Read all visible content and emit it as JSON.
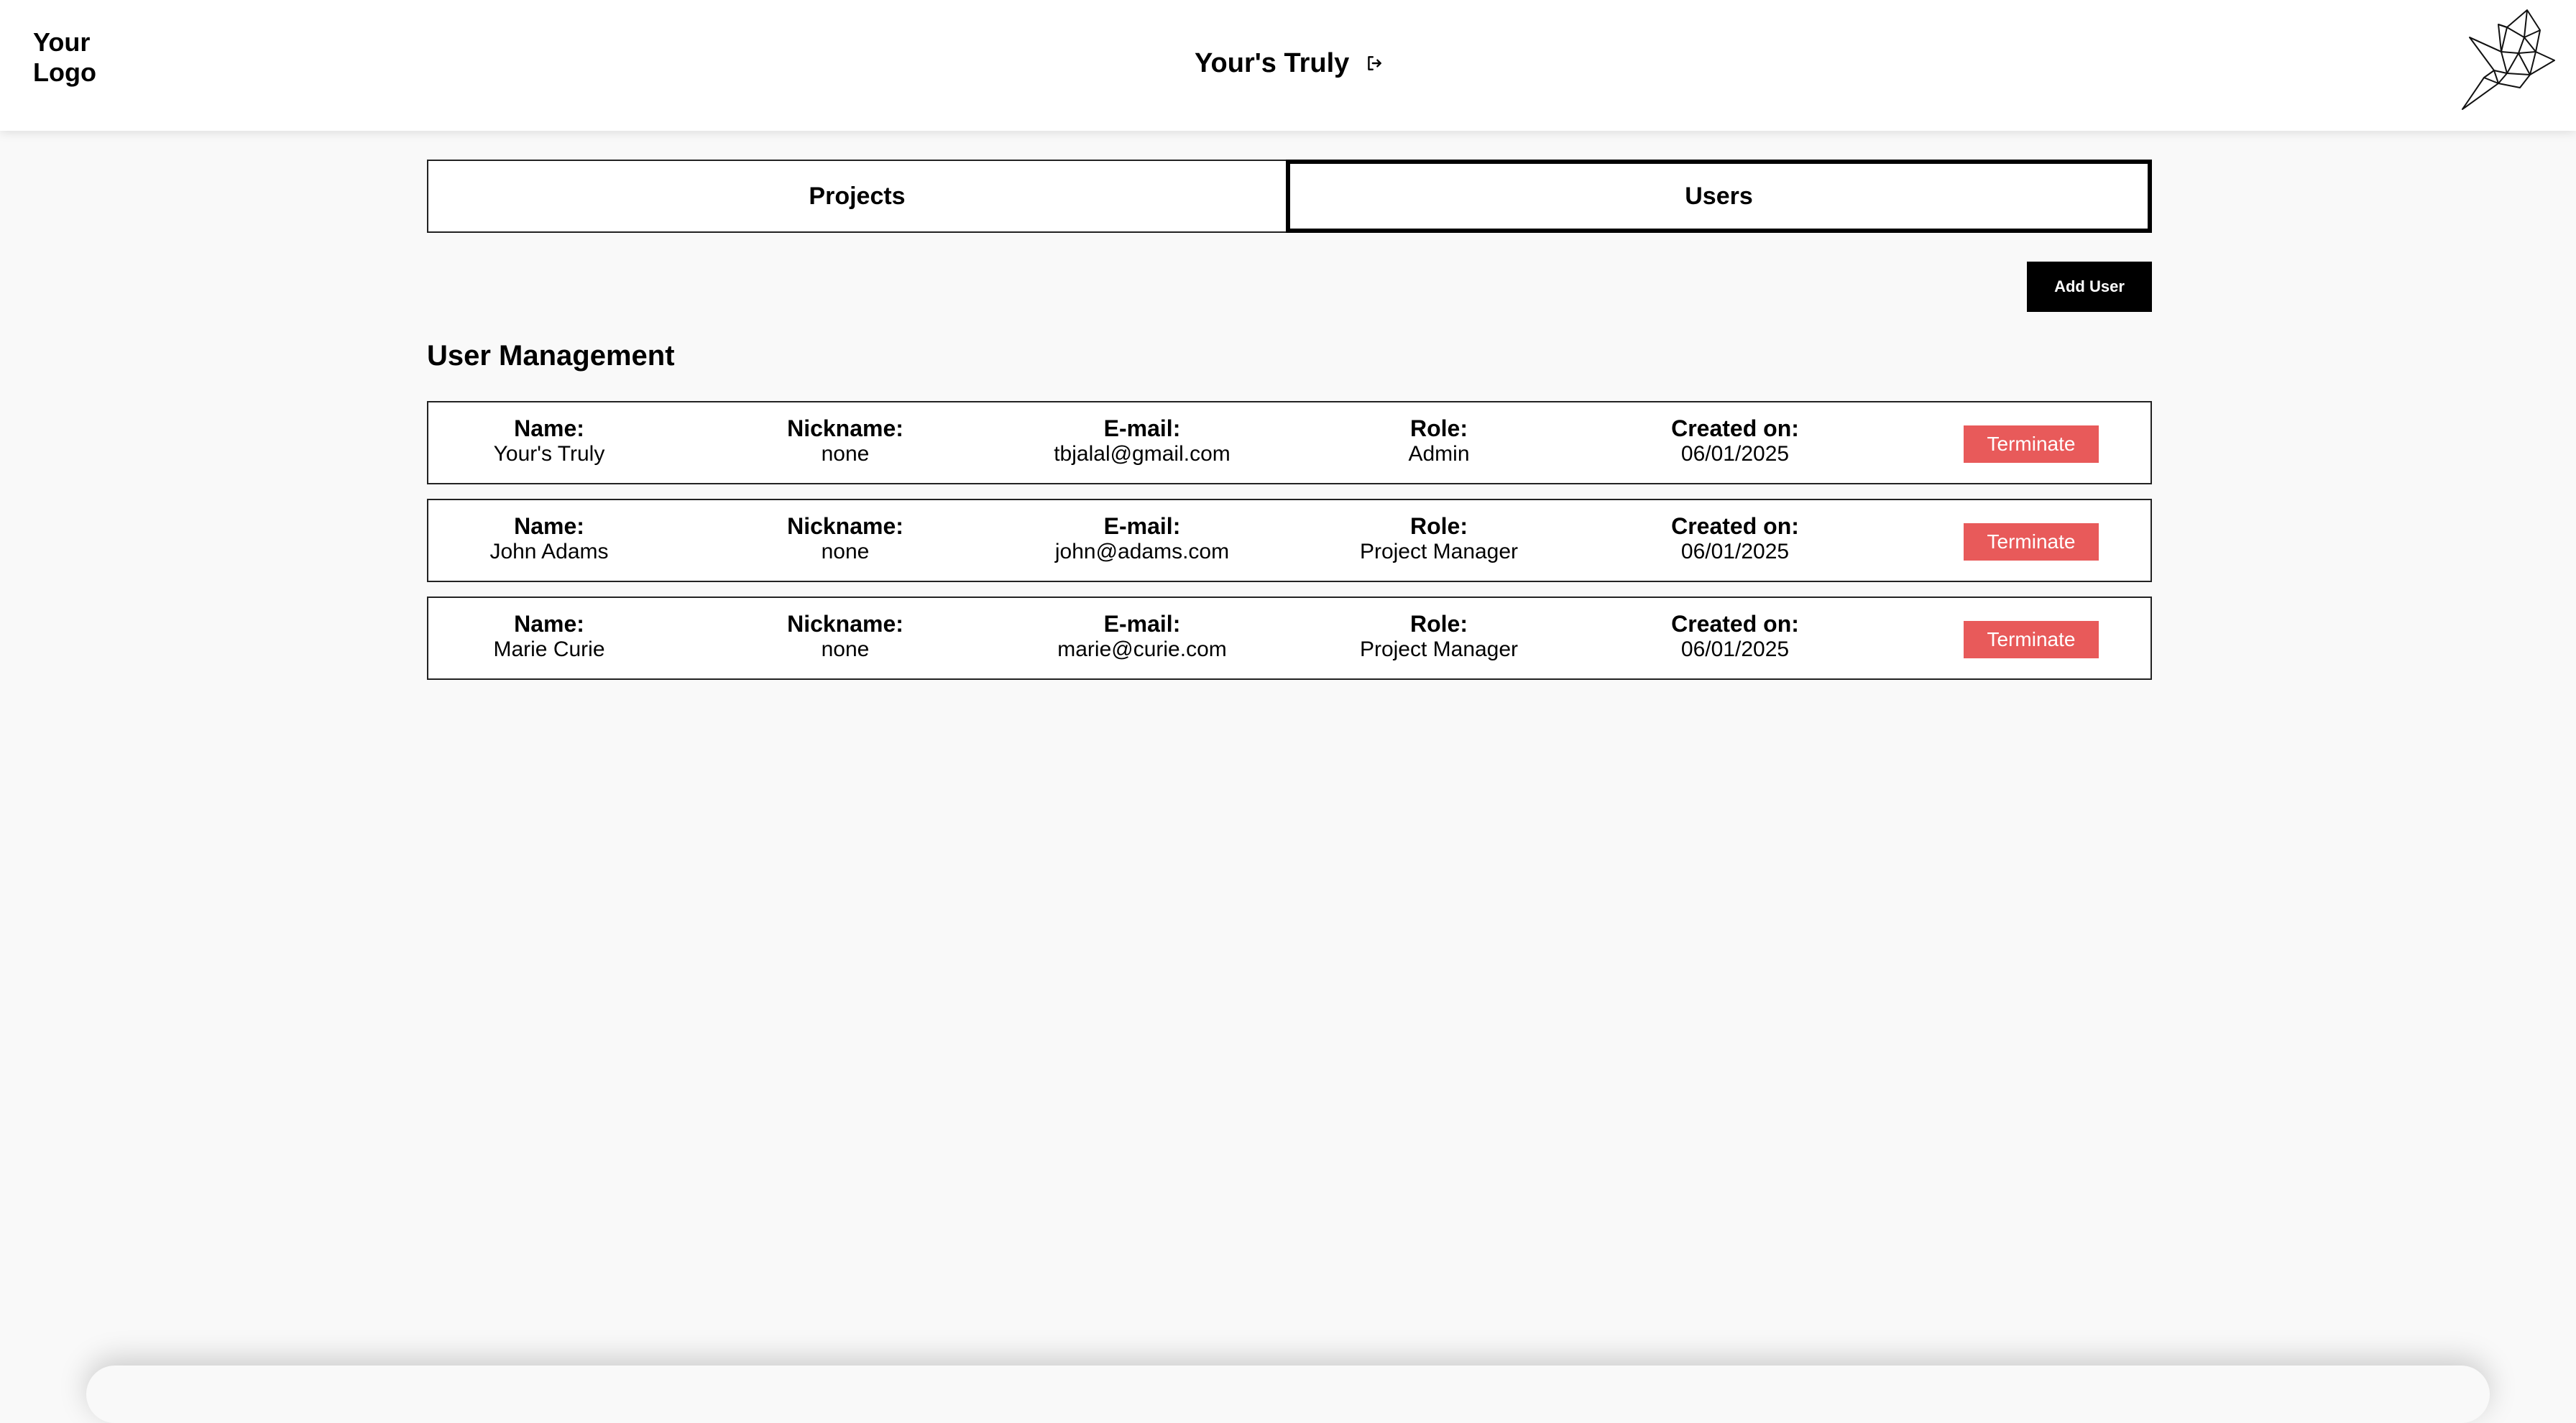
{
  "header": {
    "logo_text_line1": "Your",
    "logo_text_line2": "Logo",
    "user_name": "Your's Truly",
    "logout_icon": "logout-icon",
    "brand_icon": "origami-bird-icon"
  },
  "tabs": [
    {
      "label": "Projects",
      "active": false
    },
    {
      "label": "Users",
      "active": true
    }
  ],
  "actions": {
    "add_user_label": "Add User"
  },
  "section": {
    "title": "User Management"
  },
  "labels": {
    "name": "Name:",
    "nickname": "Nickname:",
    "email": "E-mail:",
    "role": "Role:",
    "created": "Created on:",
    "terminate": "Terminate"
  },
  "users": [
    {
      "name": "Your's Truly",
      "nickname": "none",
      "email": "tbjalal@gmail.com",
      "role": "Admin",
      "created": "06/01/2025"
    },
    {
      "name": "John Adams",
      "nickname": "none",
      "email": "john@adams.com",
      "role": "Project Manager",
      "created": "06/01/2025"
    },
    {
      "name": "Marie Curie",
      "nickname": "none",
      "email": "marie@curie.com",
      "role": "Project Manager",
      "created": "06/01/2025"
    }
  ],
  "colors": {
    "background": "#f9f9f9",
    "header_bg": "#ffffff",
    "terminate": "#e85a5a",
    "primary_button": "#000000"
  }
}
